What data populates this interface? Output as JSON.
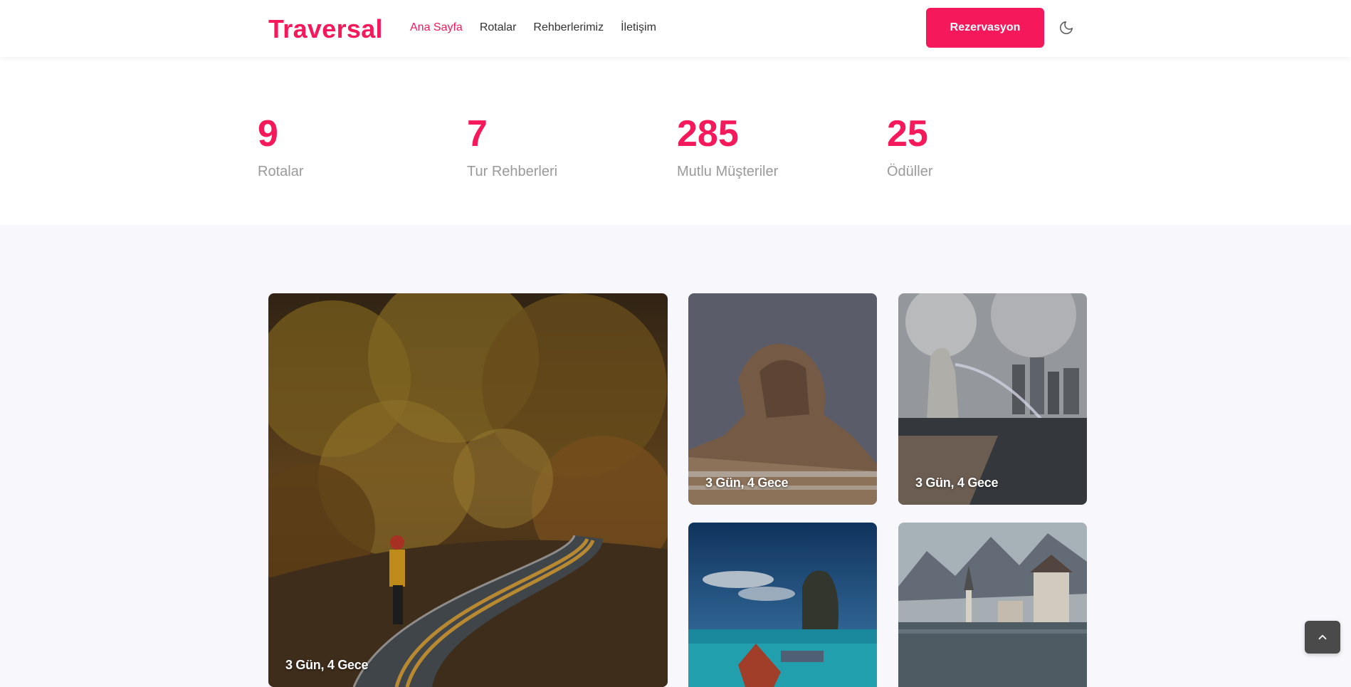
{
  "brand": {
    "name": "Traversal",
    "accent": "#f5195c"
  },
  "nav": {
    "items": [
      {
        "label": "Ana Sayfa",
        "active": true
      },
      {
        "label": "Rotalar",
        "active": false
      },
      {
        "label": "Rehberlerimiz",
        "active": false
      },
      {
        "label": "İletişim",
        "active": false
      }
    ],
    "reserve_label": "Rezervasyon",
    "theme_icon": "moon-icon"
  },
  "stats": [
    {
      "value": "9",
      "label": "Rotalar"
    },
    {
      "value": "7",
      "label": "Tur Rehberleri"
    },
    {
      "value": "285",
      "label": "Mutlu Müşteriler"
    },
    {
      "value": "25",
      "label": "Ödüller"
    }
  ],
  "tours": [
    {
      "caption": "3 Gün, 4 Gece",
      "scene": "autumn-road"
    },
    {
      "caption": "3 Gün, 4 Gece",
      "scene": "sphinx"
    },
    {
      "caption": "3 Gün, 4 Gece",
      "scene": "merlion"
    },
    {
      "caption": "",
      "scene": "sea-rock"
    },
    {
      "caption": "",
      "scene": "lake-village"
    }
  ],
  "scroll_top_icon": "chevron-up-icon"
}
